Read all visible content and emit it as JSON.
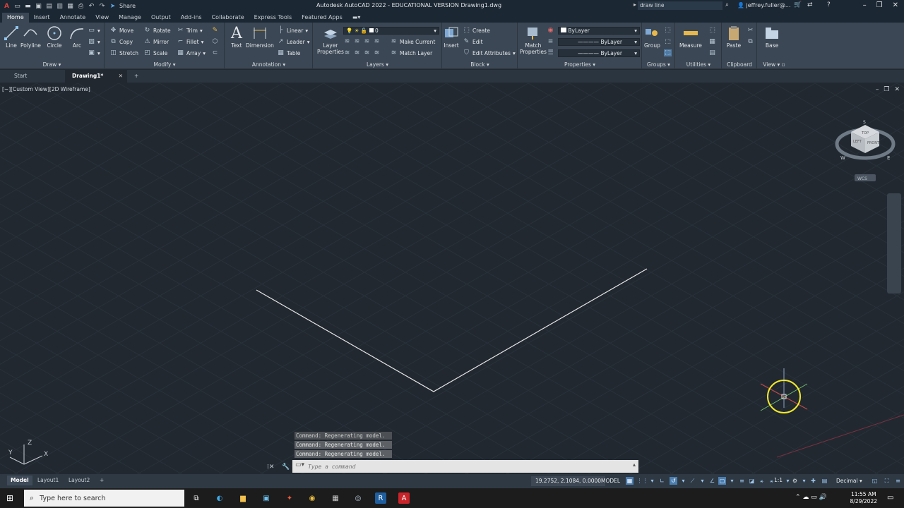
{
  "titlebar": {
    "title": "Autodesk AutoCAD 2022 - EDUCATIONAL VERSION    Drawing1.dwg",
    "share": "Share",
    "search_value": "draw line",
    "user": "jeffrey.fuller@..."
  },
  "ribbon_tabs": [
    "Home",
    "Insert",
    "Annotate",
    "View",
    "Manage",
    "Output",
    "Add-ins",
    "Collaborate",
    "Express Tools",
    "Featured Apps"
  ],
  "panels": {
    "draw": {
      "title": "Draw",
      "line": "Line",
      "polyline": "Polyline",
      "circle": "Circle",
      "arc": "Arc"
    },
    "modify": {
      "title": "Modify",
      "move": "Move",
      "rotate": "Rotate",
      "trim": "Trim",
      "copy": "Copy",
      "mirror": "Mirror",
      "fillet": "Fillet",
      "stretch": "Stretch",
      "scale": "Scale",
      "array": "Array"
    },
    "annotation": {
      "title": "Annotation",
      "text": "Text",
      "dimension": "Dimension",
      "linear": "Linear",
      "leader": "Leader",
      "table": "Table"
    },
    "layers": {
      "title": "Layers",
      "layer_properties_1": "Layer",
      "layer_properties_2": "Properties",
      "layer_value": "0",
      "make_current": "Make Current",
      "match_layer": "Match Layer"
    },
    "block": {
      "title": "Block",
      "insert": "Insert",
      "create": "Create",
      "edit": "Edit",
      "edit_attributes": "Edit Attributes"
    },
    "properties": {
      "title": "Properties",
      "match_1": "Match",
      "match_2": "Properties",
      "color": "ByLayer",
      "linetype": "ByLayer",
      "lineweight": "ByLayer"
    },
    "groups": {
      "title": "Groups",
      "group": "Group"
    },
    "utilities": {
      "title": "Utilities",
      "measure": "Measure"
    },
    "clipboard": {
      "title": "Clipboard",
      "paste": "Paste"
    },
    "view": {
      "title": "View",
      "base": "Base"
    }
  },
  "doc_tabs": {
    "start": "Start",
    "drawing": "Drawing1*"
  },
  "viewport": {
    "label": "[−][Custom View][2D Wireframe]",
    "viewcube": {
      "top": "TOP",
      "left": "LEFT",
      "front": "FRONT",
      "s": "S",
      "w": "W",
      "e": "E",
      "wcs": "WCS"
    },
    "ucs": {
      "x": "X",
      "y": "Y",
      "z": "Z"
    }
  },
  "command": {
    "history": [
      "Command:  Regenerating model.",
      "Command:  Regenerating model.",
      "Command:  Regenerating model."
    ],
    "placeholder": "Type a command"
  },
  "status": {
    "layouts": [
      "Model",
      "Layout1",
      "Layout2"
    ],
    "coords": "19.2752, 2.1084, 0.0000",
    "model": "MODEL",
    "scale": "1:1",
    "units": "Decimal"
  },
  "taskbar": {
    "search_placeholder": "Type here to search",
    "time": "11:55 AM",
    "date": "8/29/2022"
  },
  "colors": {
    "viewport_bg": "#212830",
    "ribbon_bg": "#3b4754",
    "titlebar_bg": "#1b2733",
    "cursor_highlight": "#f3ea2a"
  }
}
